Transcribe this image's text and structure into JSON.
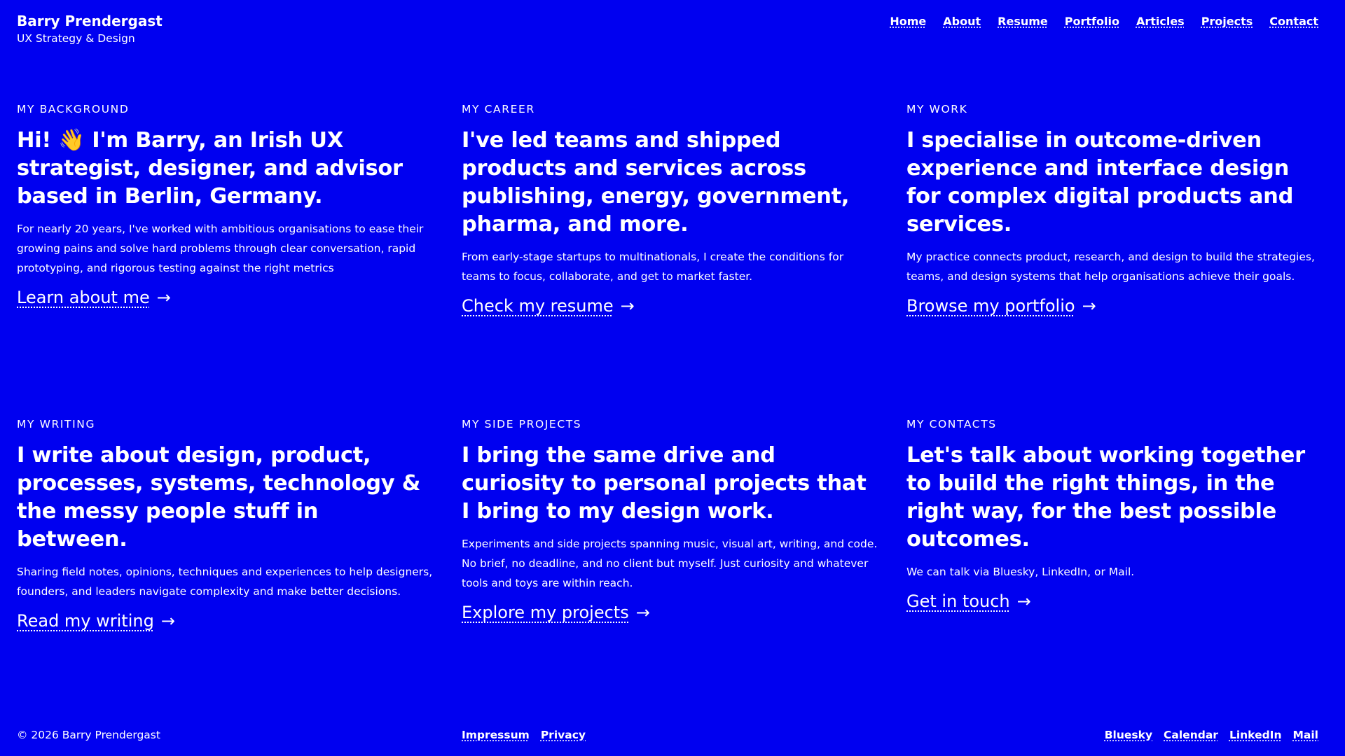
{
  "header": {
    "name": "Barry Prendergast",
    "tagline": "UX Strategy & Design",
    "nav": [
      "Home",
      "About",
      "Resume",
      "Portfolio",
      "Articles",
      "Projects",
      "Contact"
    ]
  },
  "cards": [
    {
      "eyebrow": "MY BACKGROUND",
      "heading": "Hi! 👋 I'm Barry, an Irish UX strategist, designer, and advisor based in Berlin, Germany.",
      "description": "For nearly 20 years, I've worked with ambitious organisations to ease their growing pains and solve hard problems through clear conversation, rapid prototyping, and rigorous testing against the right metrics",
      "link": "Learn about me",
      "arrow": "→"
    },
    {
      "eyebrow": "MY CAREER",
      "heading": "I've led teams and shipped products and services across publishing, energy, government, pharma, and more.",
      "description": "From early-stage startups to multinationals, I create the conditions for teams to focus, collaborate, and get to market faster.",
      "link": "Check my resume",
      "arrow": "→"
    },
    {
      "eyebrow": "MY WORK",
      "heading": "I specialise in outcome-driven experience and interface design for complex digital products and services.",
      "description": "My practice connects product, research, and design to build the strategies, teams, and design systems that help organisations achieve their goals.",
      "link": "Browse my portfolio",
      "arrow": "→"
    },
    {
      "eyebrow": "MY WRITING",
      "heading": "I write about design, product, processes, systems, technology & the messy people stuff in between.",
      "description": "Sharing field notes, opinions, techniques and experiences to help designers, founders, and leaders navigate complexity and make better decisions.",
      "link": "Read my writing",
      "arrow": "→"
    },
    {
      "eyebrow": "MY SIDE PROJECTS",
      "heading": "I bring the same drive and curiosity to personal projects that I bring to my design work.",
      "description": "Experiments and side projects spanning music, visual art, writing, and code. No brief, no deadline, and no client but myself. Just curiosity and whatever tools and toys are within reach.",
      "link": "Explore my projects",
      "arrow": "→"
    },
    {
      "eyebrow": "MY CONTACTS",
      "heading": "Let's talk about working together to build the right things, in the right way, for the best possible outcomes.",
      "description": "We can talk via Bluesky, LinkedIn, or Mail.",
      "link": "Get in touch",
      "arrow": "→"
    }
  ],
  "footer": {
    "copyright": "© 2026 Barry Prendergast",
    "legal": [
      "Impressum",
      "Privacy"
    ],
    "social": [
      "Bluesky",
      "Calendar",
      "LinkedIn",
      "Mail"
    ]
  },
  "colors": {
    "background": "#0000f0",
    "text": "#ffffff"
  }
}
